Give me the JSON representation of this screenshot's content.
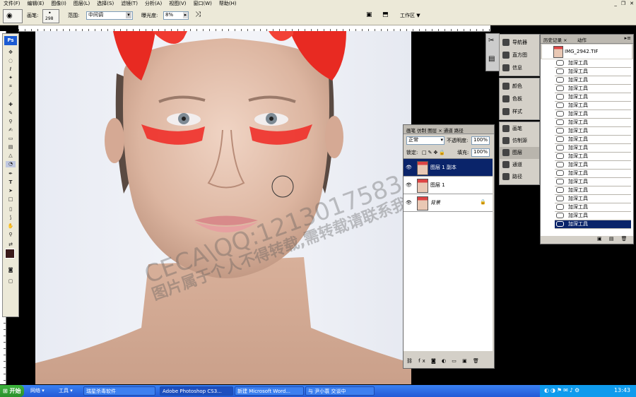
{
  "menu": [
    "文件(F)",
    "编辑(E)",
    "图像(I)",
    "图层(L)",
    "选择(S)",
    "滤镜(T)",
    "分析(A)",
    "视图(V)",
    "窗口(W)",
    "帮助(H)"
  ],
  "options": {
    "brush_label": "画笔:",
    "brush_size": "298",
    "range_label": "范围:",
    "range_value": "中间调",
    "exposure_label": "曝光度:",
    "exposure_value": "8%",
    "workspace": "工作区 ▼"
  },
  "toolbox": {
    "logo": "Ps"
  },
  "dock1": {
    "items": [
      "导航器",
      "直方图",
      "信息"
    ]
  },
  "dock2": {
    "items": [
      "颜色",
      "色板",
      "样式"
    ]
  },
  "dock3": {
    "items": [
      "画笔",
      "仿制源",
      "图层",
      "通道",
      "路径"
    ]
  },
  "layers_panel": {
    "tabs": "画笔 仿制 图层 × 通道 路径",
    "blend_mode": "正常",
    "opacity_label": "不透明度:",
    "opacity_value": "100%",
    "lock_label": "锁定:",
    "fill_label": "填充:",
    "fill_value": "100%",
    "layers": [
      {
        "name": "图层 1 副本",
        "selected": true
      },
      {
        "name": "图层 1",
        "selected": false
      },
      {
        "name": "背景",
        "selected": false
      }
    ]
  },
  "history_panel": {
    "tab_history": "历史记录 ×",
    "tab_actions": "动作",
    "snapshot": "IMG_2942.TIF",
    "items": [
      "加深工具",
      "加深工具",
      "加深工具",
      "加深工具",
      "加深工具",
      "加深工具",
      "加深工具",
      "加深工具",
      "加深工具",
      "加深工具",
      "加深工具",
      "加深工具",
      "加深工具",
      "加深工具",
      "加深工具",
      "加深工具",
      "加深工具",
      "加深工具",
      "加深工具",
      "加深工具"
    ]
  },
  "watermark": {
    "line1": "CECA\\QQ:1213017583",
    "line2": "图片属于个人不得转载,需转载请联系我"
  },
  "taskbar": {
    "start": "开始",
    "items": [
      "网络 ▾",
      "工具 ▾",
      "瑞星杀毒软件",
      "Adobe Photoshop CS3...",
      "新建 Microsoft Word...",
      "与 尹小蓑 交谈中"
    ],
    "clock": "13:43"
  },
  "colors": {
    "accent": "#0a246a",
    "fg_color": "#3a1a1a",
    "eyeshadow": "#f0302a"
  }
}
